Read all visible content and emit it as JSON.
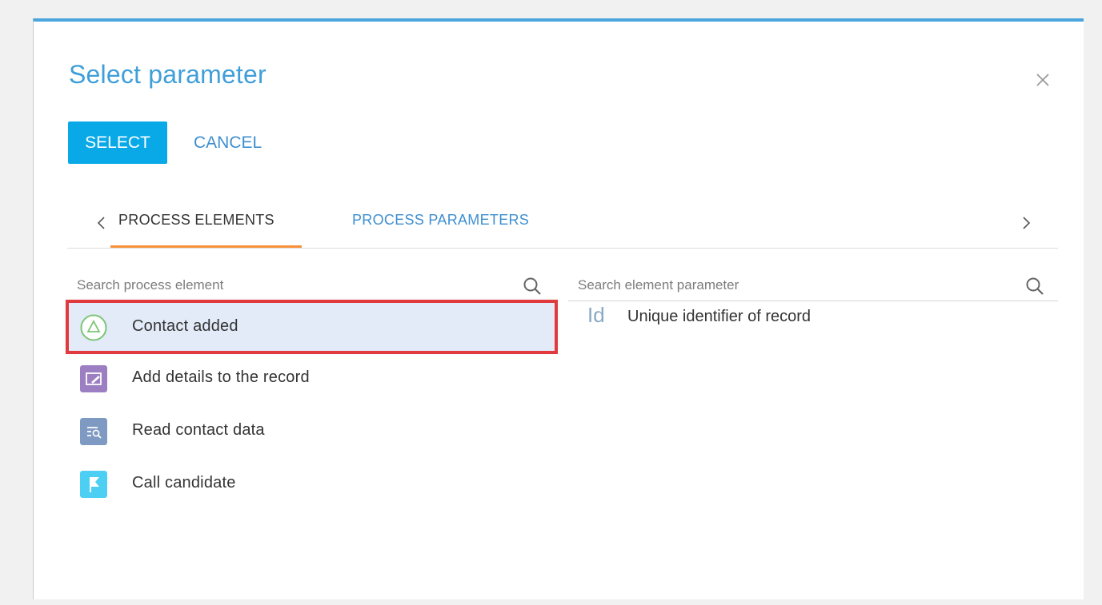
{
  "dialog": {
    "title": "Select parameter",
    "select_label": "SELECT",
    "cancel_label": "CANCEL"
  },
  "tabs": [
    {
      "label": "PROCESS ELEMENTS",
      "active": true
    },
    {
      "label": "PROCESS PARAMETERS",
      "active": false
    }
  ],
  "left_search": {
    "placeholder": "Search process element"
  },
  "right_search": {
    "placeholder": "Search element parameter"
  },
  "process_elements": [
    {
      "label": "Contact added",
      "icon": "start-signal-icon",
      "color": "#7cc576",
      "selected": true
    },
    {
      "label": "Add details to the record",
      "icon": "edit-record-icon",
      "color": "#9c7fc3",
      "selected": false
    },
    {
      "label": "Read contact data",
      "icon": "read-data-icon",
      "color": "#7f9ac2",
      "selected": false
    },
    {
      "label": "Call candidate",
      "icon": "flag-icon",
      "color": "#4dcff3",
      "selected": false
    }
  ],
  "parameters": [
    {
      "badge": "Id",
      "label": "Unique identifier of record"
    }
  ],
  "colors": {
    "accent": "#09a9e8",
    "title": "#3f9fd8",
    "link": "#3f8fd0",
    "tab_underline": "#f7923b",
    "selection_outline": "#e0393e",
    "selection_bg": "#e3eaf8"
  }
}
